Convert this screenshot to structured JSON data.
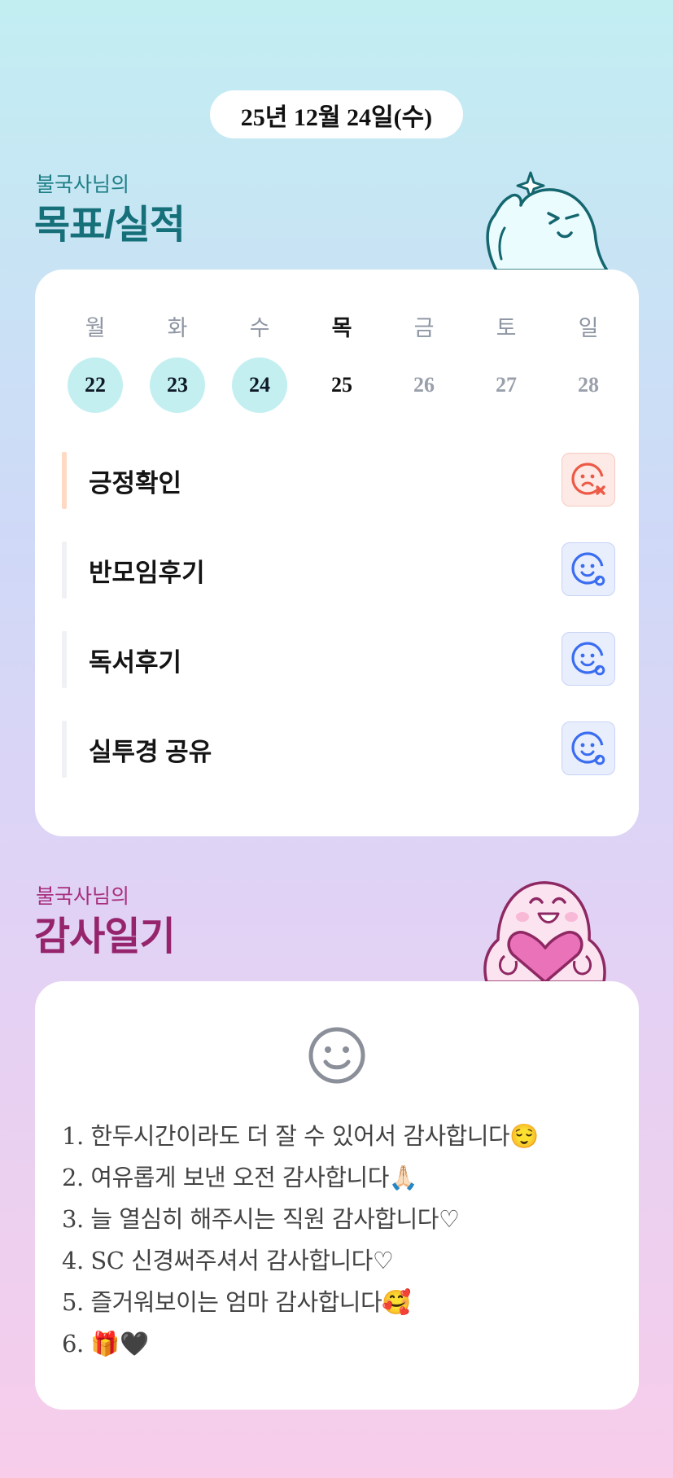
{
  "header": {
    "date": "25년 12월 24일(수)"
  },
  "goals_section": {
    "subtitle": "불국사님의",
    "title": "목표/실적",
    "mascot": "winking-mint-ghost-illustration"
  },
  "week": {
    "days": [
      {
        "name": "월",
        "num": "22",
        "status": "done"
      },
      {
        "name": "화",
        "num": "23",
        "status": "done"
      },
      {
        "name": "수",
        "num": "24",
        "status": "done"
      },
      {
        "name": "목",
        "num": "25",
        "status": "today"
      },
      {
        "name": "금",
        "num": "26",
        "status": "future"
      },
      {
        "name": "토",
        "num": "27",
        "status": "future"
      },
      {
        "name": "일",
        "num": "28",
        "status": "future"
      }
    ]
  },
  "goals": [
    {
      "label": "긍정확인",
      "status": "fail",
      "icon": "sad-face-x-icon"
    },
    {
      "label": "반모임후기",
      "status": "ok",
      "icon": "smile-face-o-icon"
    },
    {
      "label": "독서후기",
      "status": "ok",
      "icon": "smile-face-o-icon"
    },
    {
      "label": "실투경 공유",
      "status": "ok",
      "icon": "smile-face-o-icon"
    }
  ],
  "gratitude_section": {
    "subtitle": "불국사님의",
    "title": "감사일기",
    "mascot": "pink-ghost-holding-heart-illustration",
    "icon": "smile-face-icon"
  },
  "diary": {
    "lines": [
      "1. 한두시간이라도 더 잘 수 있어서 감사합니다😌",
      "2. 여유롭게 보낸 오전 감사합니다🙏🏻",
      "3. 늘 열심히 해주시는 직원 감사합니다♡",
      "4. SC 신경써주셔서 감사합니다♡",
      "5. 즐거워보이는 엄마 감사합니다🥰",
      "6. 🎁🖤"
    ]
  },
  "colors": {
    "goal_accent": "#16707a",
    "gratitude_accent": "#95246c",
    "done_day_bg": "#c3eff1",
    "fail_icon": "#ec5a47",
    "ok_icon": "#3a6df0"
  }
}
